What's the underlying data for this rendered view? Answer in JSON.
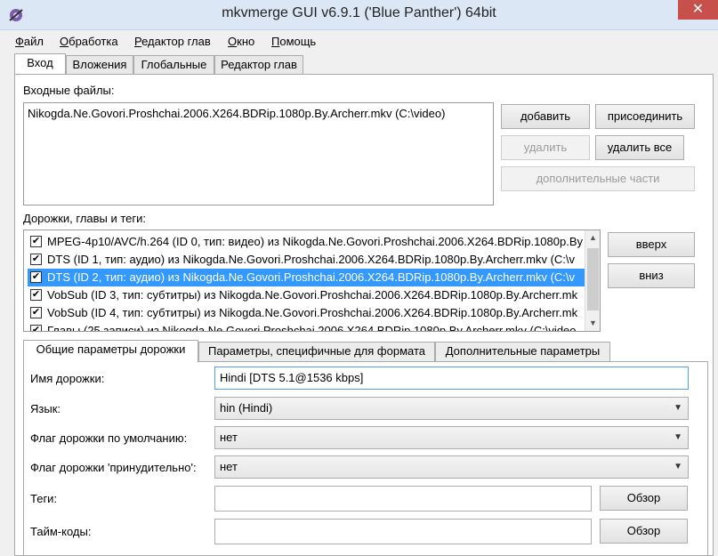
{
  "window": {
    "title": "mkvmerge GUI v6.9.1 ('Blue Panther') 64bit",
    "close_glyph": "✕"
  },
  "menu": [
    {
      "accel": "Ф",
      "rest": "айл"
    },
    {
      "accel": "О",
      "rest": "бработка"
    },
    {
      "accel": "Р",
      "rest": "едактор глав"
    },
    {
      "accel": "О",
      "rest": "кно"
    },
    {
      "accel": "П",
      "rest": "омощь"
    }
  ],
  "tabs": [
    "Вход",
    "Вложения",
    "Глобальные",
    "Редактор глав"
  ],
  "input": {
    "files_label": "Входные файлы:",
    "files": [
      "Nikogda.Ne.Govori.Proshchai.2006.X264.BDRip.1080p.By.Archerr.mkv (C:\\video)"
    ],
    "add": "добавить",
    "append": "присоединить",
    "remove": "удалить",
    "remove_all": "удалить все",
    "additional_parts": "дополнительные части"
  },
  "tracks": {
    "label": "Дорожки, главы и теги:",
    "up": "вверх",
    "down": "вниз",
    "items": [
      {
        "text": "MPEG-4p10/AVC/h.264 (ID 0, тип: видео) из Nikogda.Ne.Govori.Proshchai.2006.X264.BDRip.1080p.By",
        "checked": true,
        "selected": false
      },
      {
        "text": "DTS (ID 1, тип: аудио) из Nikogda.Ne.Govori.Proshchai.2006.X264.BDRip.1080p.By.Archerr.mkv (C:\\v",
        "checked": true,
        "selected": false
      },
      {
        "text": "DTS (ID 2, тип: аудио) из Nikogda.Ne.Govori.Proshchai.2006.X264.BDRip.1080p.By.Archerr.mkv (C:\\v",
        "checked": true,
        "selected": true
      },
      {
        "text": "VobSub (ID 3, тип: субтитры) из Nikogda.Ne.Govori.Proshchai.2006.X264.BDRip.1080p.By.Archerr.mk",
        "checked": true,
        "selected": false
      },
      {
        "text": "VobSub (ID 4, тип: субтитры) из Nikogda.Ne.Govori.Proshchai.2006.X264.BDRip.1080p.By.Archerr.mk",
        "checked": true,
        "selected": false
      },
      {
        "text": "Главы (25 записи) из Nikogda.Ne.Govori.Proshchai.2006.X264.BDRip.1080p.By.Archerr.mkv (C:\\video",
        "checked": true,
        "selected": false
      }
    ]
  },
  "subtabs": [
    "Общие параметры дорожки",
    "Параметры, специфичные для формата",
    "Дополнительные параметры"
  ],
  "general": {
    "track_name_label": "Имя дорожки:",
    "track_name_value": "Hindi [DTS 5.1@1536 kbps]",
    "language_label": "Язык:",
    "language_value": "hin (Hindi)",
    "default_flag_label": "Флаг дорожки по умолчанию:",
    "default_flag_value": "нет",
    "forced_flag_label": "Флаг дорожки 'принудительно':",
    "forced_flag_value": "нет",
    "tags_label": "Теги:",
    "tags_value": "",
    "tags_browse": "Обзор",
    "timecodes_label": "Тайм-коды:",
    "timecodes_value": "",
    "timecodes_browse": "Обзор"
  }
}
